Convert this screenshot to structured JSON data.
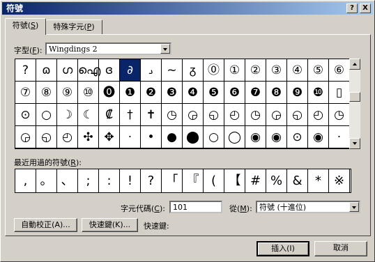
{
  "window": {
    "title": "符號",
    "help_btn": "?",
    "close_btn": "X"
  },
  "tabs": [
    {
      "label": "符號(S)",
      "key": "S"
    },
    {
      "label": "特殊字元(P)",
      "key": "P"
    }
  ],
  "tab_labels": {
    "t0a": "符號(",
    "t0k": "S",
    "t0b": ")",
    "t1a": "特殊字元(",
    "t1k": "P",
    "t1b": ")"
  },
  "font": {
    "label_a": "字型(",
    "label_k": "F",
    "label_b": "):",
    "value": "Wingdings 2"
  },
  "symbols": [
    [
      "?",
      "ɷ",
      "ഗ",
      "ഐ",
      "ɞ",
      "∂",
      "ࡅ",
      "~",
      "ᵹ",
      "⓪",
      "①",
      "②",
      "③",
      "④",
      "⑤",
      "⑥"
    ],
    [
      "⑦",
      "⑧",
      "⑨",
      "⑩",
      "⓿",
      "❶",
      "❷",
      "❸",
      "❹",
      "❺",
      "❻",
      "❼",
      "❽",
      "❾",
      "❿",
      "▯"
    ],
    [
      "⊙",
      "○",
      "☽",
      "☾",
      "₡",
      "†",
      "✝",
      "◷",
      "◶",
      "◵",
      "◴",
      "◷",
      "◶",
      "◵",
      "◴",
      "◷"
    ],
    [
      "◶",
      "◵",
      "◴",
      "✣",
      "✥",
      "·",
      "•",
      "●",
      "⬤",
      "○",
      "◯",
      "◉",
      "◉",
      "⊙",
      "◉",
      "·"
    ]
  ],
  "selected": {
    "row": 0,
    "col": 5
  },
  "recent": {
    "label_a": "最近用過的符號(",
    "label_k": "R",
    "label_b": "):",
    "items": [
      ",",
      "。",
      "、",
      ";",
      ":",
      "!",
      "?",
      "「",
      "『",
      "(",
      "【",
      "#",
      "%",
      "&",
      "*",
      "※"
    ]
  },
  "charcode": {
    "label_a": "字元代碼(",
    "label_k": "C",
    "label_b": "):",
    "value": "101"
  },
  "from": {
    "label_a": "從(",
    "label_k": "M",
    "label_b": "):",
    "value": "符號 (十進位)"
  },
  "buttons": {
    "autocorrect": "自動校正(A)...",
    "shortcut_key": "快速鍵(K)...",
    "shortcut_label": "快速鍵:",
    "insert": "插入(I)",
    "cancel": "取消"
  }
}
